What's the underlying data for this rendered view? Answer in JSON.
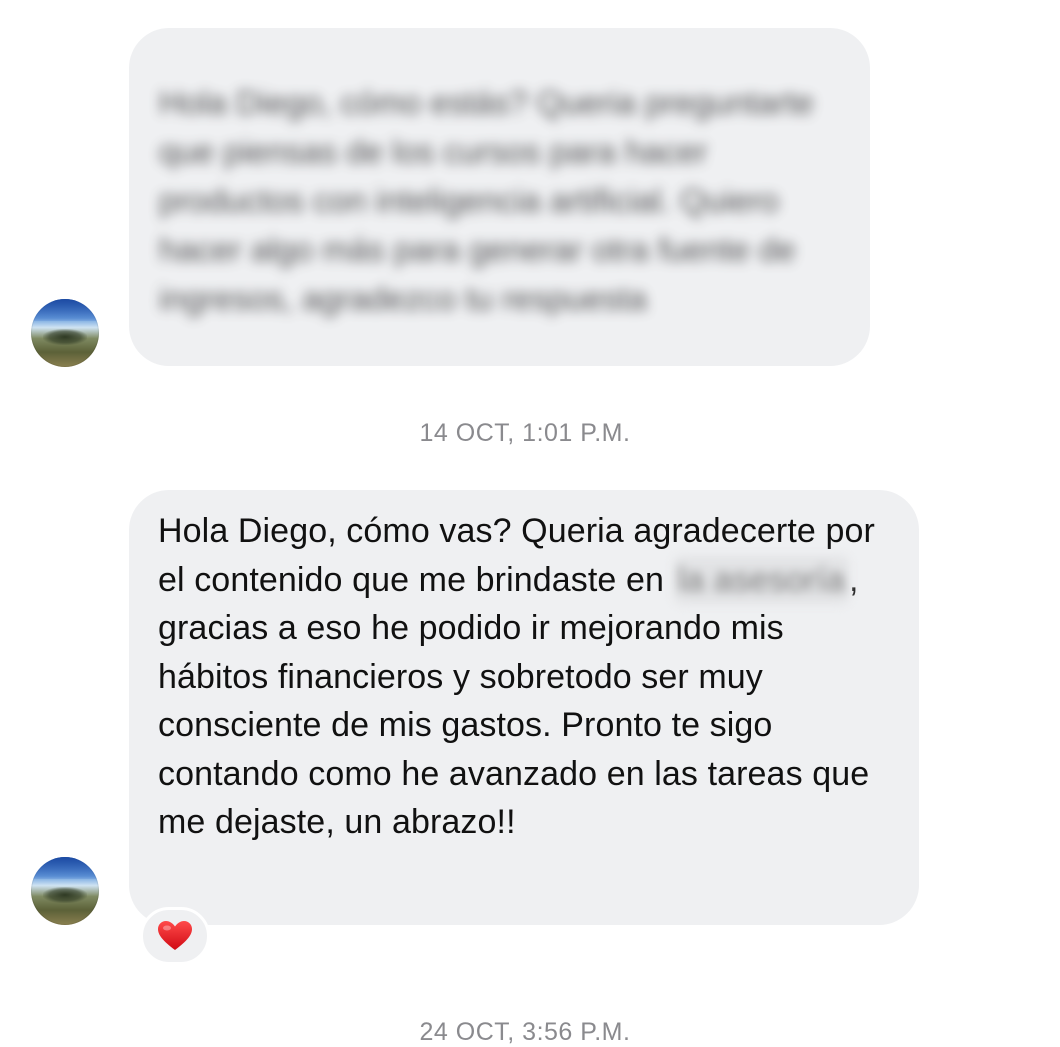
{
  "messages": [
    {
      "id": "message-1",
      "sender": "contact",
      "text": "Hola Diego, cómo estás? Queria preguntarte que piensas de los cursos para hacer productos con inteligencia artificial. Quiero hacer algo más para generar otra fuente de ingresos, agradezco tu respuesta",
      "blurred": true
    },
    {
      "id": "message-2",
      "sender": "contact",
      "text_before": "Hola Diego, cómo vas? Queria agradecerte por el contenido que me brindaste en ",
      "redacted": "la asesoría",
      "text_after": ", gracias a eso he podido ir mejorando mis hábitos financieros y sobretodo ser muy consciente de mis gastos. Pronto te sigo contando como he avanzado en las tareas que me dejaste, un abrazo!!",
      "reaction": "heart-icon"
    }
  ],
  "timestamps": {
    "first": "14 OCT, 1:01 P.M.",
    "second": "24 OCT, 3:56 P.M."
  },
  "colors": {
    "bubble": "#eff0f2",
    "timestamp": "#8a8a8e",
    "heart": "#e0101e"
  }
}
